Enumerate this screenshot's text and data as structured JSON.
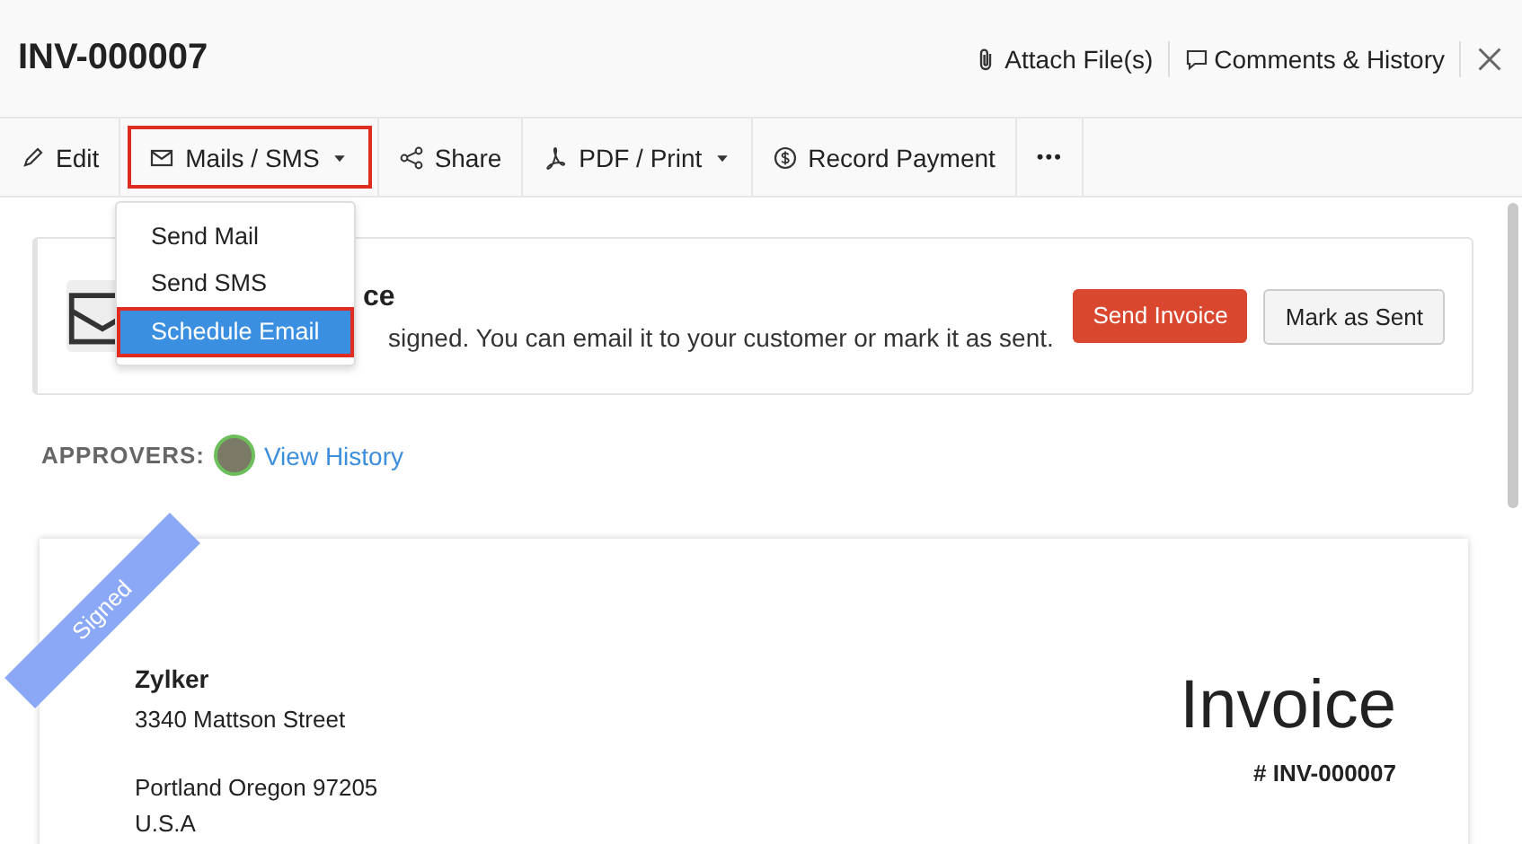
{
  "header": {
    "title": "INV-000007",
    "actions": [
      {
        "label": "Attach File(s)",
        "kind": "attach"
      },
      {
        "label": "Comments & History",
        "kind": "comments"
      }
    ]
  },
  "toolbar": [
    {
      "label": "Edit",
      "kind": "edit",
      "dropdown": false,
      "highlighted": false
    },
    {
      "label": "Mails / SMS",
      "kind": "mail",
      "dropdown": true,
      "highlighted": true
    },
    {
      "label": "Share",
      "kind": "share",
      "dropdown": false,
      "highlighted": false
    },
    {
      "label": "PDF / Print",
      "kind": "pdf",
      "dropdown": true,
      "highlighted": false
    },
    {
      "label": "Record Payment",
      "kind": "payment",
      "dropdown": false,
      "highlighted": false
    },
    {
      "label": "•••",
      "kind": "more",
      "dropdown": false,
      "highlighted": false
    }
  ],
  "menu": [
    {
      "label": "Send Mail",
      "selected": false
    },
    {
      "label": "Send SMS",
      "selected": false
    },
    {
      "label": "Schedule Email",
      "selected": true
    }
  ],
  "banner": {
    "title": "ce",
    "description": "signed. You can email it to your customer or mark it as sent.",
    "buttons": [
      {
        "label": "Send Invoice",
        "kind": "primary"
      },
      {
        "label": "Mark as Sent",
        "kind": "secondary"
      }
    ]
  },
  "approvers": {
    "label": "APPROVERS:",
    "link": "View History"
  },
  "invoice": {
    "ribbon": "Signed",
    "company": "Zylker",
    "street_lines": [
      "3340  Mattson Street"
    ],
    "city_lines": [
      "Portland Oregon 97205",
      "U.S.A"
    ],
    "heading": "Invoice",
    "number": "# INV-000007"
  }
}
